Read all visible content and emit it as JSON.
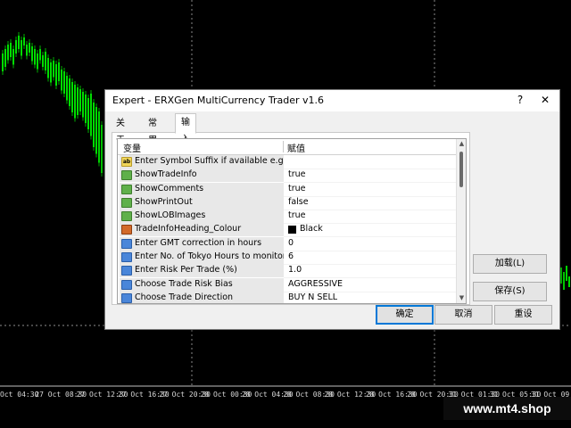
{
  "time_axis": [
    "Oct 04:30",
    "27 Oct 08:30",
    "27 Oct 12:30",
    "27 Oct 16:30",
    "27 Oct 20:30",
    "28 Oct 00:30",
    "28 Oct 04:30",
    "28 Oct 08:30",
    "28 Oct 12:30",
    "28 Oct 16:30",
    "28 Oct 20:30",
    "31 Oct 01:30",
    "31 Oct 05:30",
    "31 Oct 09"
  ],
  "watermark": "www.mt4.shop",
  "dialog": {
    "title": "Expert - ERXGen MultiCurrency Trader v1.6",
    "help": "?",
    "close": "✕",
    "tabs": [
      "关于",
      "常用",
      "输入参数"
    ],
    "active_tab": 2,
    "columns": [
      "变量",
      "赋值"
    ],
    "rows": [
      {
        "icon": "ab",
        "name": "Enter Symbol Suffix if available e.g. EU...",
        "value": ""
      },
      {
        "icon": "trend",
        "name": "ShowTradeInfo",
        "value": "true"
      },
      {
        "icon": "trend",
        "name": "ShowComments",
        "value": "true"
      },
      {
        "icon": "trend",
        "name": "ShowPrintOut",
        "value": "false"
      },
      {
        "icon": "trend",
        "name": "ShowLOBImages",
        "value": "true"
      },
      {
        "icon": "color",
        "name": "TradeInfoHeading_Colour",
        "value": "Black",
        "swatch": "#000000"
      },
      {
        "icon": "num",
        "name": "Enter GMT correction in hours",
        "value": "0"
      },
      {
        "icon": "num",
        "name": "Enter No. of Tokyo Hours to monitor",
        "value": "6"
      },
      {
        "icon": "num",
        "name": "Enter Risk Per Trade (%)",
        "value": "1.0"
      },
      {
        "icon": "num",
        "name": "Choose Trade Risk Bias",
        "value": "AGGRESSIVE"
      },
      {
        "icon": "num",
        "name": "Choose Trade Direction",
        "value": "BUY N SELL"
      }
    ],
    "buttons": {
      "load": "加载(L)",
      "save": "保存(S)",
      "ok": "确定",
      "cancel": "取消",
      "reset": "重设"
    }
  },
  "colors": {
    "candle_up": "#00dd00",
    "chart_bg": "#000000",
    "grid": "#c0c0c0"
  }
}
